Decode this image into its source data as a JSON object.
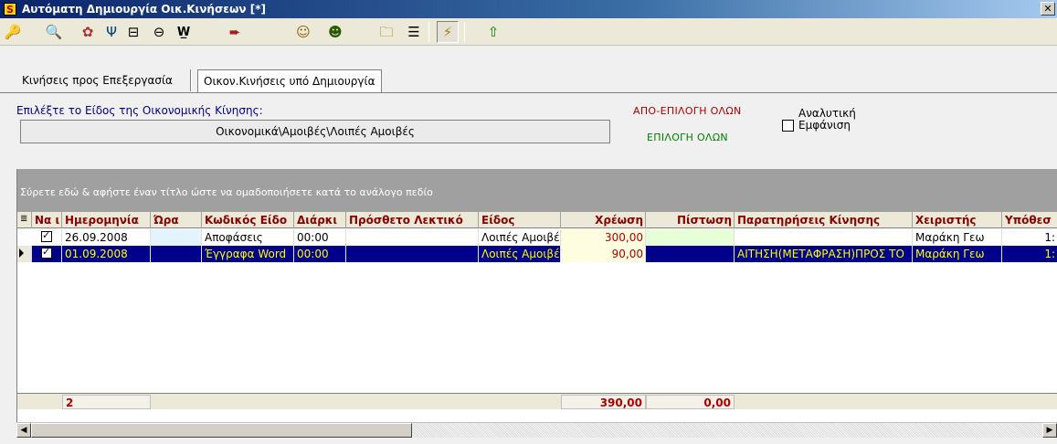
{
  "window": {
    "app_icon_letter": "S",
    "title": "Αυτόματη Δημιουργία Οικ.Κινήσεων [*]",
    "close_label": "✕"
  },
  "toolbar": {
    "buttons": [
      {
        "name": "key-icon",
        "glyph": "🔑"
      },
      {
        "name": "search-icon",
        "glyph": "🔍"
      },
      {
        "name": "tools-icon",
        "glyph": "✿"
      },
      {
        "name": "filter-icon",
        "glyph": "Ψ"
      },
      {
        "name": "tree-icon",
        "glyph": "⊟"
      },
      {
        "name": "collapse-icon",
        "glyph": "⊖"
      },
      {
        "name": "word-icon",
        "glyph": "W̲"
      },
      {
        "name": "export-icon",
        "glyph": "➨"
      },
      {
        "name": "user-face-icon",
        "glyph": "☺"
      },
      {
        "name": "person-icon",
        "glyph": "☻"
      },
      {
        "name": "folder-icon",
        "glyph": "🗀"
      },
      {
        "name": "list-icon",
        "glyph": "☰"
      },
      {
        "name": "lightning-icon",
        "glyph": "⚡"
      },
      {
        "name": "arrow-up-icon",
        "glyph": "⇧"
      }
    ]
  },
  "tabs": [
    {
      "label": "Κινήσεις προς Επεξεργασία"
    },
    {
      "label": "Οικον.Κινήσεις υπό Δημιουργία"
    }
  ],
  "form": {
    "instruction": "Επιλέξτε το Είδος της Οικονομικής Κίνησης:",
    "selected_type": "Οικονομικά\\Αμοιβές\\Λοιπές Αμοιβές",
    "deselect_all": "ΑΠΟ-ΕΠΙΛΟΓΗ ΟΛΩΝ",
    "select_all": "ΕΠΙΛΟΓΗ ΟΛΩΝ",
    "analytic_label_line1": "Αναλυτική",
    "analytic_label_line2": "Εμφάνιση",
    "analytic_checked": false
  },
  "grid": {
    "group_panel_text": "Σύρετε εδώ & αφήστε έναν τίτλο ώστε να ομαδοποιήσετε κατά το ανάλογο πεδίο",
    "columns": [
      "Να ι",
      "Ημερομηνία",
      "Ώρα",
      "Κωδικός Είδο",
      "Διάρκι",
      "Πρόσθετο Λεκτικό",
      "Είδος",
      "Χρέωση",
      "Πίστωση",
      "Παρατηρήσεις Κίνησης",
      "Χειριστής",
      "Υπόθεσ"
    ],
    "rows": [
      {
        "checked": true,
        "date": "26.09.2008",
        "hour": "",
        "code": "Αποφάσεις",
        "duration": "00:00",
        "extra": "",
        "type": "Λοιπές Αμοιβέ",
        "debit": "300,00",
        "credit": "",
        "notes": "",
        "operator": "Μαράκη Γεω",
        "case": "1:"
      },
      {
        "checked": true,
        "date": "01.09.2008",
        "hour": "",
        "code": "Έγγραφα Word",
        "duration": "00:00",
        "extra": "",
        "type": "Λοιπές Αμοιβέ",
        "debit": "90,00",
        "credit": "",
        "notes": "ΑΙΤΗΣΗ(ΜΕΤΑΦΡΑΣΗ)ΠΡΟΣ ΤΟ",
        "operator": "Μαράκη Γεω",
        "case": "1:"
      }
    ],
    "footer": {
      "count": "2",
      "debit_total": "390,00",
      "credit_total": "0,00"
    }
  },
  "scrollbar": {
    "left_arrow": "◀",
    "right_arrow": "▶"
  }
}
